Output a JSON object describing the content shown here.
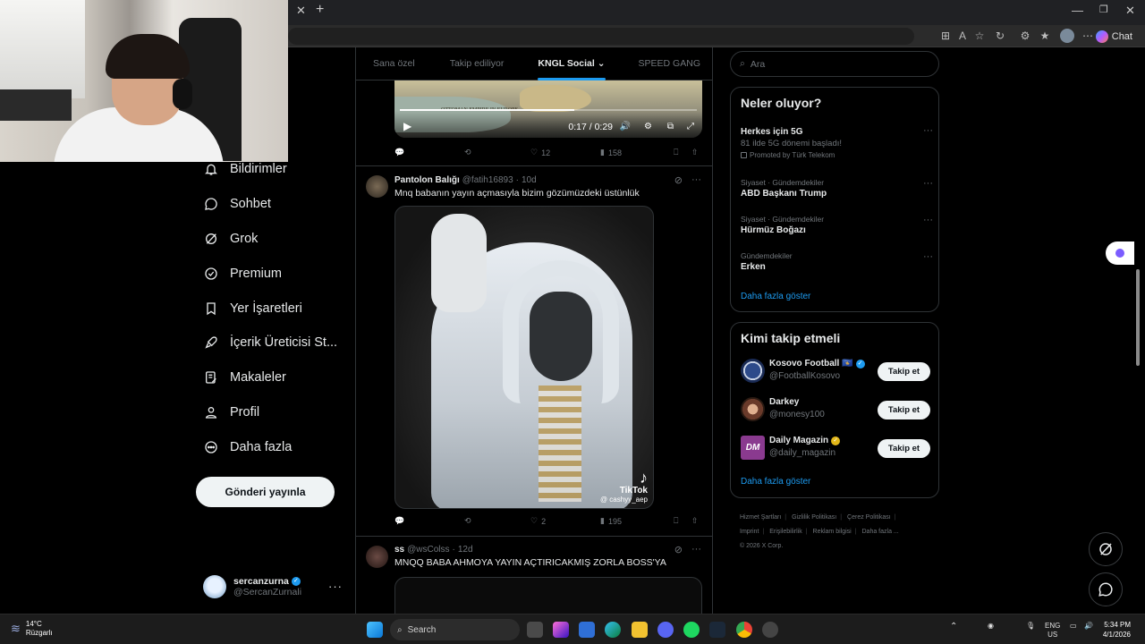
{
  "browser": {
    "chat_label": "Chat"
  },
  "nav": {
    "items": [
      {
        "label": "Bildirimler",
        "icon": "bell-icon"
      },
      {
        "label": "Sohbet",
        "icon": "chat-icon"
      },
      {
        "label": "Grok",
        "icon": "grok-icon"
      },
      {
        "label": "Premium",
        "icon": "premium-icon"
      },
      {
        "label": "Yer İşaretleri",
        "icon": "bookmark-icon"
      },
      {
        "label": "İçerik Üreticisi St...",
        "icon": "rocket-icon"
      },
      {
        "label": "Makaleler",
        "icon": "article-icon"
      },
      {
        "label": "Profil",
        "icon": "profile-icon"
      },
      {
        "label": "Daha fazla",
        "icon": "more-circle-icon"
      }
    ],
    "post_button": "Gönderi yayınla",
    "account": {
      "name": "sercanzurna",
      "handle": "@SercanZurnali"
    }
  },
  "feed": {
    "tabs": [
      "Sana özel",
      "Takip ediliyor",
      "KNGL Social",
      "SPEED GANG"
    ],
    "active_tab": "KNGL Social",
    "video_top": {
      "time": "0:17 / 0:29",
      "progress": 0.586,
      "map_caption": "OTTOMAN EMPIRE IN EUROPE",
      "actions": {
        "replies": "",
        "reposts": "",
        "likes": "12",
        "views": "158"
      }
    },
    "tweets": [
      {
        "name": "Pantolon Balığı",
        "handle": "@fatih16893",
        "age": "10d",
        "text": "Mnq babanın yayın açmasıyla bizim gözümüzdeki üstünlük",
        "tiktok": {
          "brand": "TikTok",
          "user": "@ cashyy_aep"
        },
        "actions": {
          "replies": "",
          "reposts": "",
          "likes": "2",
          "views": "195"
        }
      },
      {
        "name": "ss",
        "handle": "@wsColss",
        "age": "12d",
        "text": "MNQQ BABA AHMOYA YAYIN AÇTIRICAKMIŞ ZORLA BOSS'YA"
      }
    ]
  },
  "sidebar": {
    "search_placeholder": "Ara",
    "trends_title": "Neler oluyor?",
    "trends": [
      {
        "category": "",
        "name": "Herkes için 5G",
        "sub": "81 ilde 5G dönemi başladı!",
        "promo": "Promoted by Türk Telekom"
      },
      {
        "category": "Siyaset · Gündemdekiler",
        "name": "ABD Başkanı Trump"
      },
      {
        "category": "Siyaset · Gündemdekiler",
        "name": "Hürmüz Boğazı"
      },
      {
        "category": "Gündemdekiler",
        "name": "Erken"
      }
    ],
    "trends_more": "Daha fazla göster",
    "who_title": "Kimi takip etmeli",
    "who": [
      {
        "name": "Kosovo Football 🇽🇰",
        "handle": "@FootballKosovo",
        "badge": "blue"
      },
      {
        "name": "Darkey",
        "handle": "@monesy100",
        "badge": ""
      },
      {
        "name": "Daily Magazin",
        "handle": "@daily_magazin",
        "badge": "gold"
      }
    ],
    "who_follow": "Takip et",
    "who_more": "Daha fazla göster",
    "footer": [
      "Hizmet Şartları",
      "Gizlilik Politikası",
      "Çerez Politikası",
      "Imprint",
      "Erişilebilirlik",
      "Reklam bilgisi",
      "Daha fazla ...",
      "© 2026 X Corp."
    ]
  },
  "taskbar": {
    "weather_temp": "14°C",
    "weather_desc": "Rüzgarlı",
    "search": "Search",
    "lang1": "ENG",
    "lang2": "US",
    "time": "5:34 PM",
    "date": "4/1/2026"
  },
  "colors": {
    "accent": "#1d9bf0",
    "background": "#000000",
    "gold": "#e2b719"
  }
}
